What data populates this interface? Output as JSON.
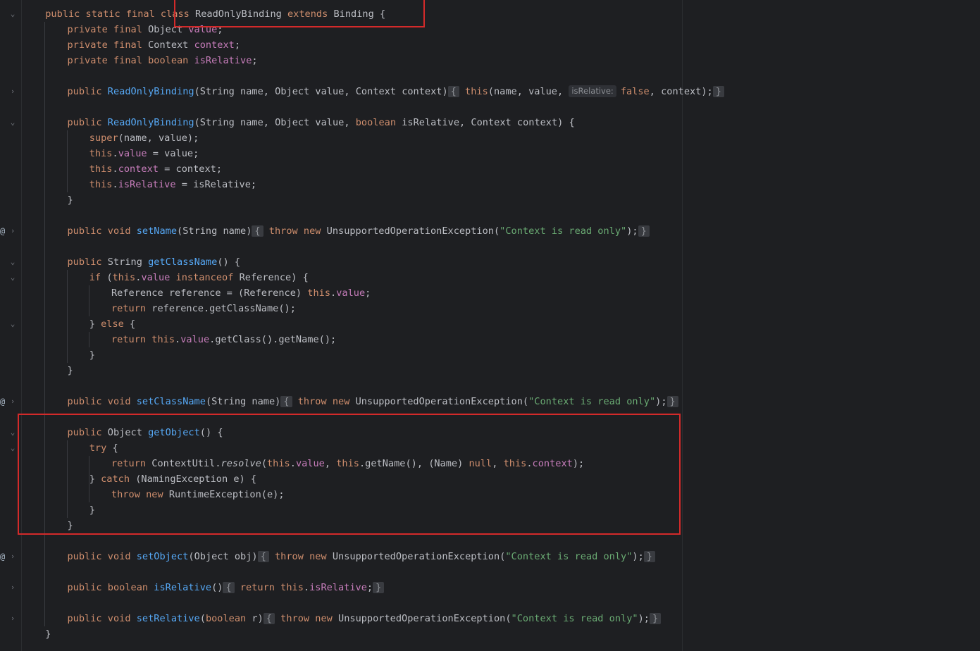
{
  "editor": {
    "gutter_marks": [
      {
        "type": "fold",
        "glyph": "⌄"
      },
      {
        "type": "fold",
        "glyph": "›"
      },
      {
        "type": "fold",
        "glyph": "⌄"
      },
      {
        "type": "fold",
        "glyph": "›"
      },
      {
        "type": "fold",
        "glyph": "⌄"
      },
      {
        "type": "fold",
        "glyph": "⌄"
      },
      {
        "type": "fold",
        "glyph": "⌄"
      },
      {
        "type": "fold",
        "glyph": "›"
      },
      {
        "type": "fold",
        "glyph": "⌄"
      },
      {
        "type": "fold",
        "glyph": "⌄"
      },
      {
        "type": "fold",
        "glyph": "›"
      },
      {
        "type": "fold",
        "glyph": "›"
      },
      {
        "type": "fold",
        "glyph": "›"
      },
      {
        "type": "override",
        "glyph": "@"
      },
      {
        "type": "override",
        "glyph": "@"
      },
      {
        "type": "override",
        "glyph": "@"
      }
    ],
    "lines": [
      {
        "row": 0,
        "indent": 1,
        "tokens": [
          [
            "k",
            "public static final class "
          ],
          [
            "",
            "ReadOnlyBinding "
          ],
          [
            "k",
            "extends "
          ],
          [
            "",
            "Binding {"
          ]
        ]
      },
      {
        "row": 1,
        "indent": 2,
        "tokens": [
          [
            "k",
            "private final "
          ],
          [
            "",
            "Object "
          ],
          [
            "fd",
            "value"
          ],
          [
            "",
            ";"
          ]
        ]
      },
      {
        "row": 2,
        "indent": 2,
        "tokens": [
          [
            "k",
            "private final "
          ],
          [
            "",
            "Context "
          ],
          [
            "fd",
            "context"
          ],
          [
            "",
            ";"
          ]
        ]
      },
      {
        "row": 3,
        "indent": 2,
        "tokens": [
          [
            "k",
            "private final boolean "
          ],
          [
            "fd",
            "isRelative"
          ],
          [
            "",
            ";"
          ]
        ]
      },
      {
        "row": 5,
        "indent": 2,
        "tokens": [
          [
            "k",
            "public "
          ],
          [
            "f",
            "ReadOnlyBinding"
          ],
          [
            "",
            "(String name, Object value, Context context)"
          ],
          [
            "fold",
            "{"
          ],
          [
            "k",
            " this"
          ],
          [
            "",
            "(name, value, "
          ],
          [
            "hint",
            "isRelative:"
          ],
          [
            "k",
            "false"
          ],
          [
            "",
            ", context);"
          ],
          [
            "fold",
            "}"
          ]
        ]
      },
      {
        "row": 7,
        "indent": 2,
        "tokens": [
          [
            "k",
            "public "
          ],
          [
            "f",
            "ReadOnlyBinding"
          ],
          [
            "",
            "(String name, Object value, "
          ],
          [
            "k",
            "boolean "
          ],
          [
            "",
            "isRelative, Context context) {"
          ]
        ]
      },
      {
        "row": 8,
        "indent": 3,
        "tokens": [
          [
            "k",
            "super"
          ],
          [
            "",
            "(name, value);"
          ]
        ]
      },
      {
        "row": 9,
        "indent": 3,
        "tokens": [
          [
            "k",
            "this"
          ],
          [
            "",
            "."
          ],
          [
            "fd",
            "value"
          ],
          [
            "",
            " = value;"
          ]
        ]
      },
      {
        "row": 10,
        "indent": 3,
        "tokens": [
          [
            "k",
            "this"
          ],
          [
            "",
            "."
          ],
          [
            "fd",
            "context"
          ],
          [
            "",
            " = context;"
          ]
        ]
      },
      {
        "row": 11,
        "indent": 3,
        "tokens": [
          [
            "k",
            "this"
          ],
          [
            "",
            "."
          ],
          [
            "fd",
            "isRelative"
          ],
          [
            "",
            " = isRelative;"
          ]
        ]
      },
      {
        "row": 12,
        "indent": 2,
        "tokens": [
          [
            "",
            "}"
          ]
        ]
      },
      {
        "row": 14,
        "indent": 2,
        "tokens": [
          [
            "k",
            "public void "
          ],
          [
            "f",
            "setName"
          ],
          [
            "",
            "(String name)"
          ],
          [
            "fold",
            "{"
          ],
          [
            "k",
            " throw new "
          ],
          [
            "",
            "UnsupportedOperationException("
          ],
          [
            "s",
            "\"Context is read only\""
          ],
          [
            "",
            ");"
          ],
          [
            "fold",
            "}"
          ]
        ]
      },
      {
        "row": 16,
        "indent": 2,
        "tokens": [
          [
            "k",
            "public "
          ],
          [
            "",
            "String "
          ],
          [
            "f",
            "getClassName"
          ],
          [
            "",
            "() {"
          ]
        ]
      },
      {
        "row": 17,
        "indent": 3,
        "tokens": [
          [
            "k",
            "if "
          ],
          [
            "",
            "("
          ],
          [
            "k",
            "this"
          ],
          [
            "",
            "."
          ],
          [
            "fd",
            "value "
          ],
          [
            "k",
            "instanceof "
          ],
          [
            "",
            "Reference) {"
          ]
        ]
      },
      {
        "row": 18,
        "indent": 4,
        "tokens": [
          [
            "",
            "Reference reference = (Reference) "
          ],
          [
            "k",
            "this"
          ],
          [
            "",
            "."
          ],
          [
            "fd",
            "value"
          ],
          [
            "",
            ";"
          ]
        ]
      },
      {
        "row": 19,
        "indent": 4,
        "tokens": [
          [
            "k",
            "return "
          ],
          [
            "",
            "reference.getClassName();"
          ]
        ]
      },
      {
        "row": 20,
        "indent": 3,
        "tokens": [
          [
            "",
            "} "
          ],
          [
            "k",
            "else "
          ],
          [
            "",
            "{"
          ]
        ]
      },
      {
        "row": 21,
        "indent": 4,
        "tokens": [
          [
            "k",
            "return this"
          ],
          [
            "",
            "."
          ],
          [
            "fd",
            "value"
          ],
          [
            "",
            ".getClass().getName();"
          ]
        ]
      },
      {
        "row": 22,
        "indent": 3,
        "tokens": [
          [
            "",
            "}"
          ]
        ]
      },
      {
        "row": 23,
        "indent": 2,
        "tokens": [
          [
            "",
            "}"
          ]
        ]
      },
      {
        "row": 25,
        "indent": 2,
        "tokens": [
          [
            "k",
            "public void "
          ],
          [
            "f",
            "setClassName"
          ],
          [
            "",
            "(String name)"
          ],
          [
            "fold",
            "{"
          ],
          [
            "k",
            " throw new "
          ],
          [
            "",
            "UnsupportedOperationException("
          ],
          [
            "s",
            "\"Context is read only\""
          ],
          [
            "",
            ");"
          ],
          [
            "fold",
            "}"
          ]
        ]
      },
      {
        "row": 27,
        "indent": 2,
        "tokens": [
          [
            "k",
            "public "
          ],
          [
            "",
            "Object "
          ],
          [
            "f",
            "getObject"
          ],
          [
            "",
            "() {"
          ]
        ]
      },
      {
        "row": 28,
        "indent": 3,
        "tokens": [
          [
            "k",
            "try "
          ],
          [
            "",
            "{"
          ]
        ]
      },
      {
        "row": 29,
        "indent": 4,
        "tokens": [
          [
            "k",
            "return "
          ],
          [
            "",
            "ContextUtil."
          ],
          [
            "it",
            "resolve"
          ],
          [
            "",
            "("
          ],
          [
            "k",
            "this"
          ],
          [
            "",
            "."
          ],
          [
            "fd",
            "value"
          ],
          [
            "",
            ", "
          ],
          [
            "k",
            "this"
          ],
          [
            "",
            ".getName(), (Name) "
          ],
          [
            "k",
            "null"
          ],
          [
            "",
            ", "
          ],
          [
            "k",
            "this"
          ],
          [
            "",
            "."
          ],
          [
            "fd",
            "context"
          ],
          [
            "",
            ");"
          ]
        ]
      },
      {
        "row": 30,
        "indent": 3,
        "tokens": [
          [
            "",
            "} "
          ],
          [
            "k",
            "catch "
          ],
          [
            "",
            "(NamingException e) {"
          ]
        ]
      },
      {
        "row": 31,
        "indent": 4,
        "tokens": [
          [
            "k",
            "throw new "
          ],
          [
            "",
            "RuntimeException(e);"
          ]
        ]
      },
      {
        "row": 32,
        "indent": 3,
        "tokens": [
          [
            "",
            "}"
          ]
        ]
      },
      {
        "row": 33,
        "indent": 2,
        "tokens": [
          [
            "",
            "}"
          ]
        ]
      },
      {
        "row": 35,
        "indent": 2,
        "tokens": [
          [
            "k",
            "public void "
          ],
          [
            "f",
            "setObject"
          ],
          [
            "",
            "(Object obj)"
          ],
          [
            "fold",
            "{"
          ],
          [
            "k",
            " throw new "
          ],
          [
            "",
            "UnsupportedOperationException("
          ],
          [
            "s",
            "\"Context is read only\""
          ],
          [
            "",
            ");"
          ],
          [
            "fold",
            "}"
          ]
        ]
      },
      {
        "row": 37,
        "indent": 2,
        "tokens": [
          [
            "k",
            "public boolean "
          ],
          [
            "f",
            "isRelative"
          ],
          [
            "",
            "()"
          ],
          [
            "fold",
            "{"
          ],
          [
            "k",
            " return this"
          ],
          [
            "",
            "."
          ],
          [
            "fd",
            "isRelative"
          ],
          [
            "",
            ";"
          ],
          [
            "fold",
            "}"
          ]
        ]
      },
      {
        "row": 39,
        "indent": 2,
        "tokens": [
          [
            "k",
            "public void "
          ],
          [
            "f",
            "setRelative"
          ],
          [
            "",
            "("
          ],
          [
            "k",
            "boolean "
          ],
          [
            "",
            "r)"
          ],
          [
            "fold",
            "{"
          ],
          [
            "k",
            " throw new "
          ],
          [
            "",
            "UnsupportedOperationException("
          ],
          [
            "s",
            "\"Context is read only\""
          ],
          [
            "",
            ");"
          ],
          [
            "fold",
            "}"
          ]
        ]
      },
      {
        "row": 40,
        "indent": 1,
        "tokens": [
          [
            "",
            "}"
          ]
        ]
      }
    ]
  },
  "colors": {
    "background": "#1e1f22",
    "keyword": "#cf8e6d",
    "function": "#56a8f5",
    "field": "#c77dbb",
    "string": "#6aab73",
    "default_text": "#bcbec4",
    "highlight_box": "#d32a2a"
  }
}
